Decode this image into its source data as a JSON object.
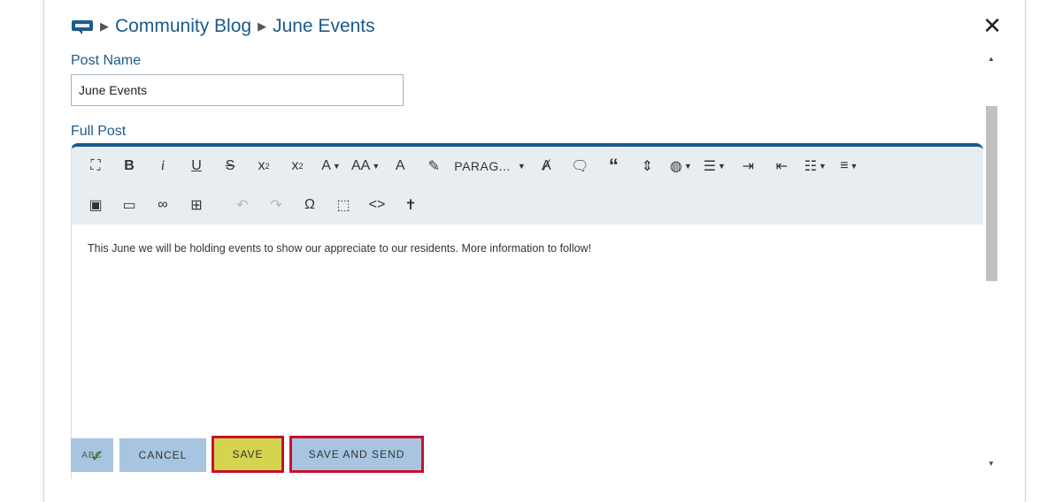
{
  "breadcrumb": {
    "root": "Community Blog",
    "current": "June Events",
    "separator": "▶"
  },
  "form": {
    "post_name_label": "Post Name",
    "post_name_value": "June Events",
    "full_post_label": "Full Post"
  },
  "toolbar": {
    "paragraph_format": "PARAG..."
  },
  "editor": {
    "content": "This June we will be holding events to show our appreciate to our residents. More information to follow!"
  },
  "buttons": {
    "spell": "ABC",
    "cancel": "CANCEL",
    "save": "SAVE",
    "save_and_send": "SAVE AND SEND"
  },
  "colors": {
    "brand": "#1c5b8a",
    "button_blue": "#a7c5e1",
    "save_yellow": "#d5d44f",
    "highlight_red": "#c8102e"
  }
}
